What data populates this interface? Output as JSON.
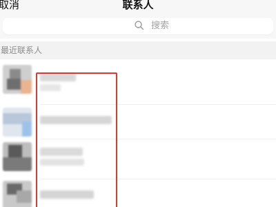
{
  "header": {
    "cancel_label": "取消",
    "title": "联系人"
  },
  "search": {
    "placeholder": "搜索",
    "icon": "search-icon"
  },
  "section": {
    "label": "最近联系人"
  },
  "contacts": [
    {
      "name_redacted": true
    },
    {
      "name_redacted": true
    },
    {
      "name_redacted": true
    },
    {
      "name_redacted": true
    }
  ],
  "colors": {
    "highlight": "#d93a2b",
    "background": "#f7f7f7",
    "section_text": "#8b8b8b"
  }
}
